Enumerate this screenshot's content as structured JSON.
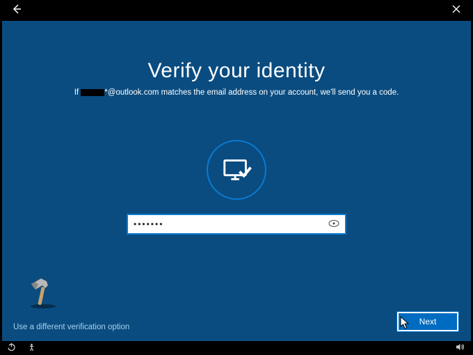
{
  "title": "Verify your identity",
  "subtitle_prefix": "If ",
  "subtitle_email_domain": "*@outlook.com",
  "subtitle_suffix": " matches the email address on your account, we'll send you a code.",
  "input_value_mask": "•••••••",
  "alt_link": "Use a different verification option",
  "next_button": "Next",
  "colors": {
    "background": "#0a4c80",
    "accent": "#006cc1",
    "circle_border": "#0a7ad1"
  }
}
